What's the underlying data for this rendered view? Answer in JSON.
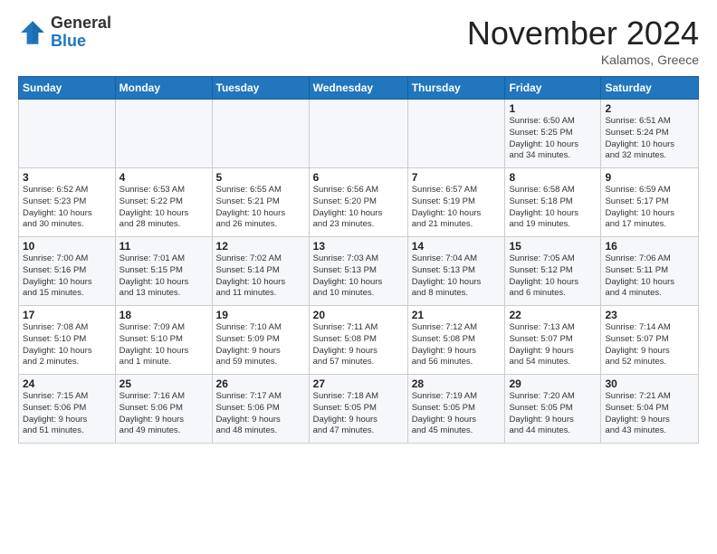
{
  "logo": {
    "general": "General",
    "blue": "Blue"
  },
  "header": {
    "month": "November 2024",
    "location": "Kalamos, Greece"
  },
  "weekdays": [
    "Sunday",
    "Monday",
    "Tuesday",
    "Wednesday",
    "Thursday",
    "Friday",
    "Saturday"
  ],
  "weeks": [
    [
      {
        "day": "",
        "info": ""
      },
      {
        "day": "",
        "info": ""
      },
      {
        "day": "",
        "info": ""
      },
      {
        "day": "",
        "info": ""
      },
      {
        "day": "",
        "info": ""
      },
      {
        "day": "1",
        "info": "Sunrise: 6:50 AM\nSunset: 5:25 PM\nDaylight: 10 hours\nand 34 minutes."
      },
      {
        "day": "2",
        "info": "Sunrise: 6:51 AM\nSunset: 5:24 PM\nDaylight: 10 hours\nand 32 minutes."
      }
    ],
    [
      {
        "day": "3",
        "info": "Sunrise: 6:52 AM\nSunset: 5:23 PM\nDaylight: 10 hours\nand 30 minutes."
      },
      {
        "day": "4",
        "info": "Sunrise: 6:53 AM\nSunset: 5:22 PM\nDaylight: 10 hours\nand 28 minutes."
      },
      {
        "day": "5",
        "info": "Sunrise: 6:55 AM\nSunset: 5:21 PM\nDaylight: 10 hours\nand 26 minutes."
      },
      {
        "day": "6",
        "info": "Sunrise: 6:56 AM\nSunset: 5:20 PM\nDaylight: 10 hours\nand 23 minutes."
      },
      {
        "day": "7",
        "info": "Sunrise: 6:57 AM\nSunset: 5:19 PM\nDaylight: 10 hours\nand 21 minutes."
      },
      {
        "day": "8",
        "info": "Sunrise: 6:58 AM\nSunset: 5:18 PM\nDaylight: 10 hours\nand 19 minutes."
      },
      {
        "day": "9",
        "info": "Sunrise: 6:59 AM\nSunset: 5:17 PM\nDaylight: 10 hours\nand 17 minutes."
      }
    ],
    [
      {
        "day": "10",
        "info": "Sunrise: 7:00 AM\nSunset: 5:16 PM\nDaylight: 10 hours\nand 15 minutes."
      },
      {
        "day": "11",
        "info": "Sunrise: 7:01 AM\nSunset: 5:15 PM\nDaylight: 10 hours\nand 13 minutes."
      },
      {
        "day": "12",
        "info": "Sunrise: 7:02 AM\nSunset: 5:14 PM\nDaylight: 10 hours\nand 11 minutes."
      },
      {
        "day": "13",
        "info": "Sunrise: 7:03 AM\nSunset: 5:13 PM\nDaylight: 10 hours\nand 10 minutes."
      },
      {
        "day": "14",
        "info": "Sunrise: 7:04 AM\nSunset: 5:13 PM\nDaylight: 10 hours\nand 8 minutes."
      },
      {
        "day": "15",
        "info": "Sunrise: 7:05 AM\nSunset: 5:12 PM\nDaylight: 10 hours\nand 6 minutes."
      },
      {
        "day": "16",
        "info": "Sunrise: 7:06 AM\nSunset: 5:11 PM\nDaylight: 10 hours\nand 4 minutes."
      }
    ],
    [
      {
        "day": "17",
        "info": "Sunrise: 7:08 AM\nSunset: 5:10 PM\nDaylight: 10 hours\nand 2 minutes."
      },
      {
        "day": "18",
        "info": "Sunrise: 7:09 AM\nSunset: 5:10 PM\nDaylight: 10 hours\nand 1 minute."
      },
      {
        "day": "19",
        "info": "Sunrise: 7:10 AM\nSunset: 5:09 PM\nDaylight: 9 hours\nand 59 minutes."
      },
      {
        "day": "20",
        "info": "Sunrise: 7:11 AM\nSunset: 5:08 PM\nDaylight: 9 hours\nand 57 minutes."
      },
      {
        "day": "21",
        "info": "Sunrise: 7:12 AM\nSunset: 5:08 PM\nDaylight: 9 hours\nand 56 minutes."
      },
      {
        "day": "22",
        "info": "Sunrise: 7:13 AM\nSunset: 5:07 PM\nDaylight: 9 hours\nand 54 minutes."
      },
      {
        "day": "23",
        "info": "Sunrise: 7:14 AM\nSunset: 5:07 PM\nDaylight: 9 hours\nand 52 minutes."
      }
    ],
    [
      {
        "day": "24",
        "info": "Sunrise: 7:15 AM\nSunset: 5:06 PM\nDaylight: 9 hours\nand 51 minutes."
      },
      {
        "day": "25",
        "info": "Sunrise: 7:16 AM\nSunset: 5:06 PM\nDaylight: 9 hours\nand 49 minutes."
      },
      {
        "day": "26",
        "info": "Sunrise: 7:17 AM\nSunset: 5:06 PM\nDaylight: 9 hours\nand 48 minutes."
      },
      {
        "day": "27",
        "info": "Sunrise: 7:18 AM\nSunset: 5:05 PM\nDaylight: 9 hours\nand 47 minutes."
      },
      {
        "day": "28",
        "info": "Sunrise: 7:19 AM\nSunset: 5:05 PM\nDaylight: 9 hours\nand 45 minutes."
      },
      {
        "day": "29",
        "info": "Sunrise: 7:20 AM\nSunset: 5:05 PM\nDaylight: 9 hours\nand 44 minutes."
      },
      {
        "day": "30",
        "info": "Sunrise: 7:21 AM\nSunset: 5:04 PM\nDaylight: 9 hours\nand 43 minutes."
      }
    ]
  ]
}
